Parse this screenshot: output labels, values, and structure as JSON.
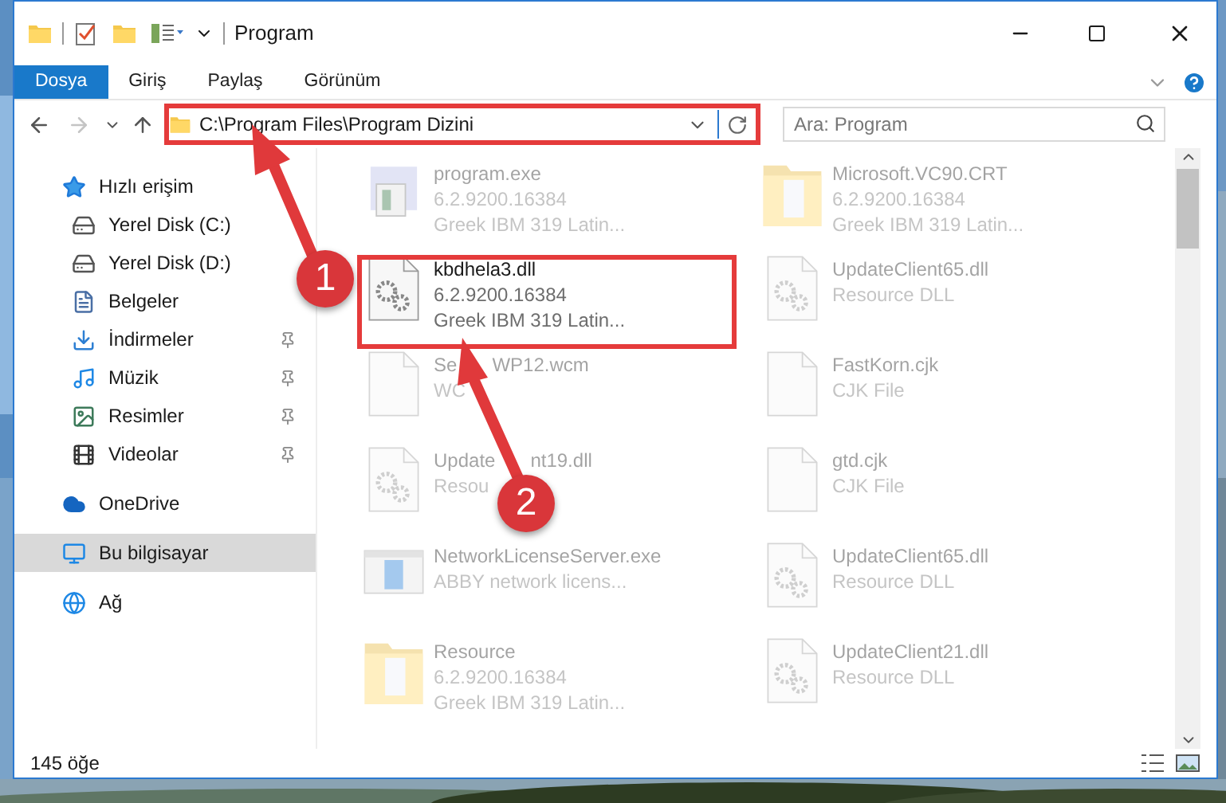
{
  "window": {
    "title": "Program"
  },
  "ribbon_tabs": [
    {
      "label": "Dosya",
      "selected": true
    },
    {
      "label": "Giriş",
      "selected": false
    },
    {
      "label": "Paylaş",
      "selected": false
    },
    {
      "label": "Görünüm",
      "selected": false
    }
  ],
  "navigation": {
    "forward_disabled": true,
    "address": "C:\\Program Files\\Program Dizini",
    "search": {
      "placeholder": "Ara: Program"
    }
  },
  "sidebar": {
    "items": [
      {
        "label": "Hızlı erişim",
        "selected": false,
        "children": [
          {
            "label": "Yerel Disk (C:)"
          },
          {
            "label": "Yerel Disk (D:)"
          },
          {
            "label": "Belgeler"
          },
          {
            "label": "İndirmeler",
            "pinned": true
          },
          {
            "label": "Müzik",
            "pinned": true
          },
          {
            "label": "Resimler",
            "pinned": true
          },
          {
            "label": "Videolar",
            "pinned": true
          }
        ]
      },
      {
        "label": "OneDrive",
        "selected": false
      },
      {
        "label": "Bu bilgisayar",
        "selected": true
      },
      {
        "label": "Ağ",
        "selected": false
      }
    ]
  },
  "files": [
    {
      "name_parts": [
        "program.exe"
      ],
      "details": [
        "6.2.9200.16384",
        "Greek IBM 319 Latin..."
      ],
      "kind": "exe",
      "dimmed": true
    },
    {
      "name_parts": [
        "Microsoft.VC90.CRT"
      ],
      "details": [
        "6.2.9200.16384",
        "Greek IBM 319 Latin..."
      ],
      "kind": "folder",
      "dimmed": true
    },
    {
      "name_parts": [
        "kbdhela3.dll"
      ],
      "details": [
        "6.2.9200.16384",
        "Greek IBM 319 Latin..."
      ],
      "kind": "dll",
      "dimmed": false
    },
    {
      "name_parts": [
        "UpdateClient65.dll"
      ],
      "details": [
        "Resource DLL"
      ],
      "kind": "dll",
      "dimmed": true
    },
    {
      "name_parts": [
        "Se",
        "WP12.wcm"
      ],
      "details": [
        "WC"
      ],
      "kind": "file",
      "dimmed": true
    },
    {
      "name_parts": [
        "FastKorn.cjk"
      ],
      "details": [
        "CJK File"
      ],
      "kind": "file",
      "dimmed": true
    },
    {
      "name_parts": [
        "Update",
        "nt19.dll"
      ],
      "details": [
        "Resou"
      ],
      "kind": "dll",
      "dimmed": true
    },
    {
      "name_parts": [
        "gtd.cjk"
      ],
      "details": [
        "CJK File"
      ],
      "kind": "file",
      "dimmed": true
    },
    {
      "name_parts": [
        "NetworkLicenseServer.exe"
      ],
      "details": [
        "ABBY network licens..."
      ],
      "kind": "app",
      "dimmed": true
    },
    {
      "name_parts": [
        "UpdateClient65.dll"
      ],
      "details": [
        "Resource DLL"
      ],
      "kind": "dll",
      "dimmed": true
    },
    {
      "name_parts": [
        "Resource"
      ],
      "details": [
        "6.2.9200.16384",
        "Greek IBM 319 Latin..."
      ],
      "kind": "folder",
      "dimmed": true
    },
    {
      "name_parts": [
        "UpdateClient21.dll"
      ],
      "details": [
        "Resource DLL"
      ],
      "kind": "dll",
      "dimmed": true
    }
  ],
  "status_bar": {
    "count": "145 öğe"
  },
  "annotations": [
    {
      "number": "1"
    },
    {
      "number": "2"
    }
  ]
}
